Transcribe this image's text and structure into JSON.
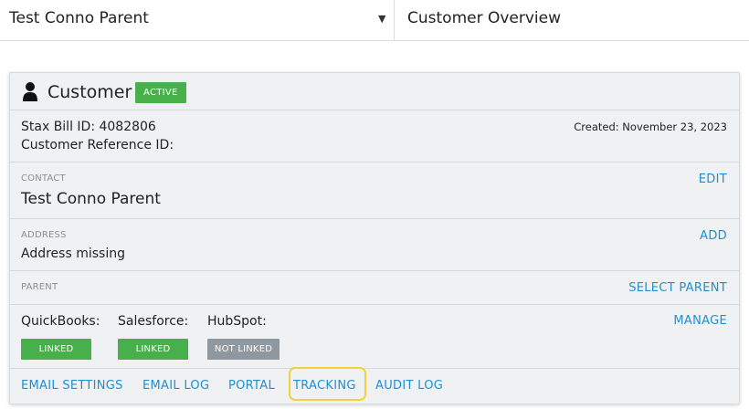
{
  "header": {
    "customer_select_value": "Test Conno Parent",
    "page_title": "Customer Overview"
  },
  "card": {
    "title": "Customer",
    "status_badge": "ACTIVE",
    "stax_bill_id": "Stax Bill ID: 4082806",
    "customer_reference": "Customer Reference ID:",
    "created": "Created: November 23, 2023",
    "contact": {
      "label": "CONTACT",
      "name": "Test Conno Parent",
      "action": "EDIT"
    },
    "address": {
      "label": "ADDRESS",
      "value": "Address missing",
      "action": "ADD"
    },
    "parent": {
      "label": "PARENT",
      "action": "SELECT PARENT"
    },
    "integrations": {
      "action": "MANAGE",
      "items": [
        {
          "name": "QuickBooks:",
          "status": "LINKED"
        },
        {
          "name": "Salesforce:",
          "status": "LINKED"
        },
        {
          "name": "HubSpot:",
          "status": "NOT LINKED"
        }
      ]
    },
    "footer_links": [
      "EMAIL SETTINGS",
      "EMAIL LOG",
      "PORTAL",
      "TRACKING",
      "AUDIT LOG"
    ]
  },
  "colors": {
    "accent_link": "#1f8fd4",
    "linked_green": "#47b04b",
    "not_linked_grey": "#8f989f",
    "highlight_yellow": "#f1d23e"
  },
  "icons": {
    "customer": "person-icon",
    "dropdown": "caret-down-icon"
  }
}
